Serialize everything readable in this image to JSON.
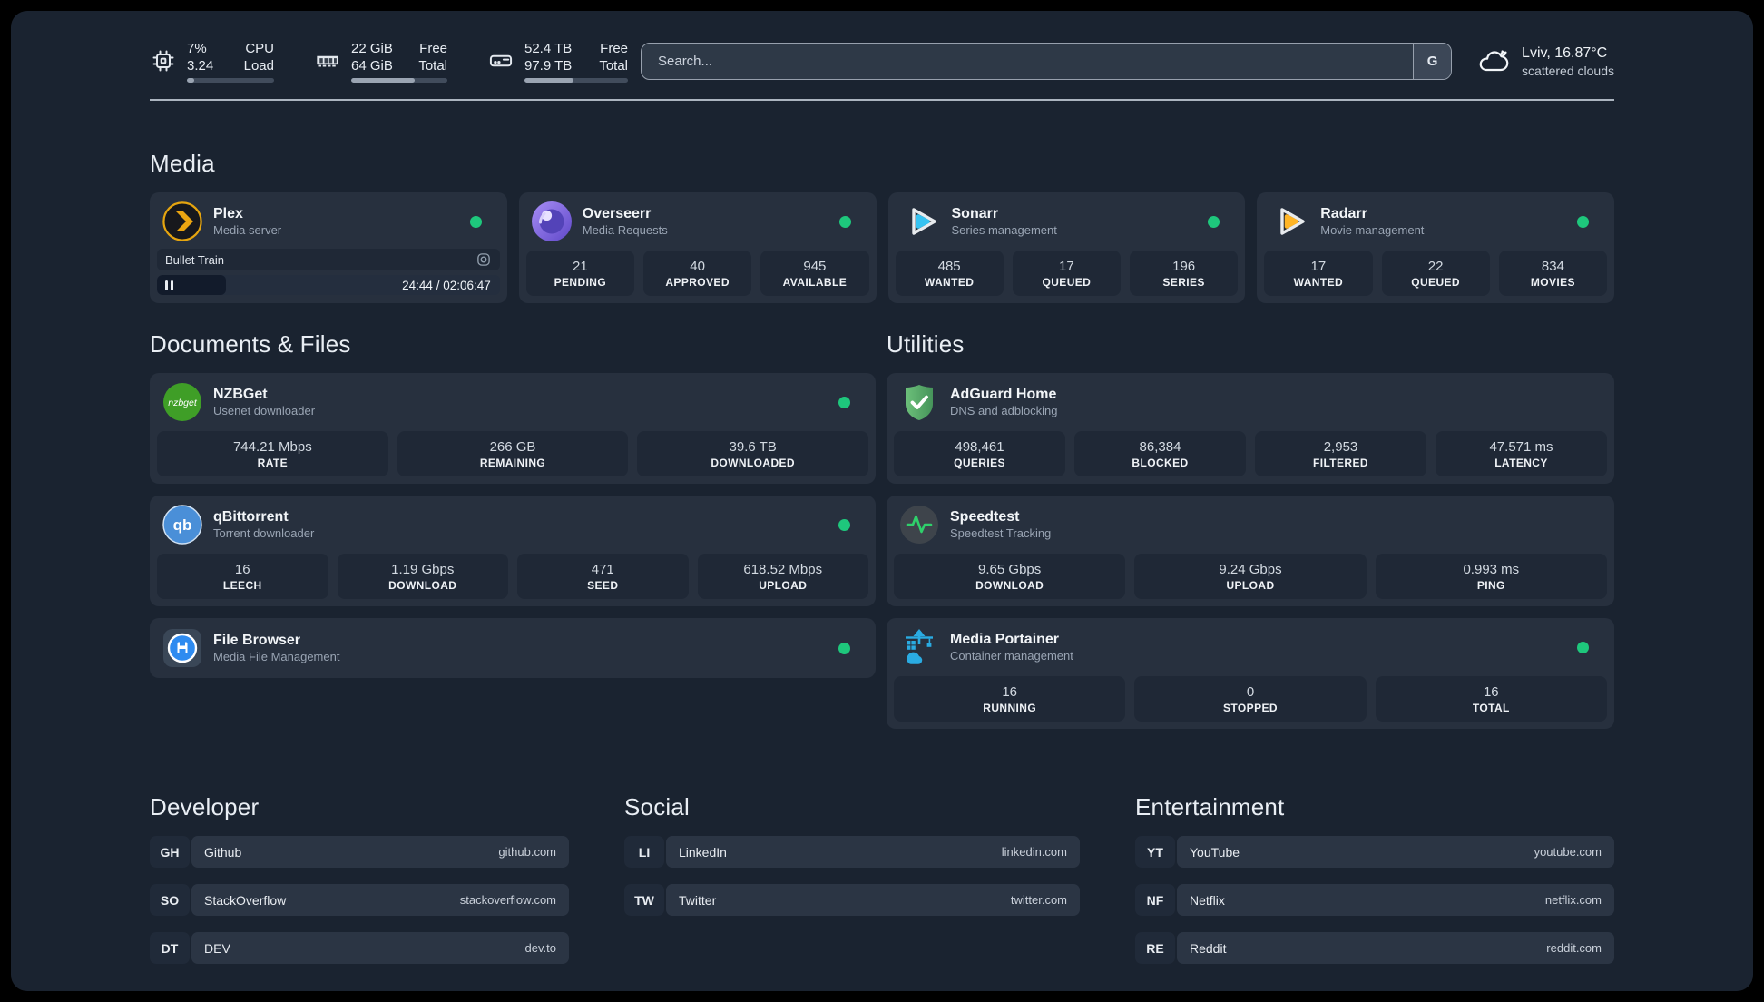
{
  "colors": {
    "status_online": "#1ec77c",
    "page_background": "#1a2330",
    "card_background": "#27303e",
    "plex_amber": "#e5a00d",
    "sonarr_blue": "#37c3f1",
    "radarr_amber": "#ffb526",
    "nzbget_green": "#3f9e27",
    "qbittorrent_blue": "#4a8fd8",
    "adguard_green": "#5cb46c",
    "speedtest_pulse": "#2fd06b",
    "portainer_blue": "#2aabe2",
    "filebrowser_blue": "#2e8bf0"
  },
  "header": {
    "cpu": {
      "top_value": "7%",
      "bottom_value": "3.24",
      "top_label": "CPU",
      "bottom_label": "Load",
      "progress_pct": 8
    },
    "memory": {
      "top_value": "22 GiB",
      "bottom_value": "64 GiB",
      "top_label": "Free",
      "bottom_label": "Total",
      "progress_pct": 66
    },
    "storage": {
      "top_value": "52.4 TB",
      "bottom_value": "97.9 TB",
      "top_label": "Free",
      "bottom_label": "Total",
      "progress_pct": 47
    },
    "search": {
      "placeholder": "Search...",
      "engine_button": "G"
    },
    "weather": {
      "location_temperature": "Lviv, 16.87°C",
      "condition": "scattered clouds"
    }
  },
  "sections": {
    "media": {
      "title": "Media",
      "plex": {
        "name": "Plex",
        "description": "Media server",
        "status": "online",
        "now_playing": {
          "title": "Bullet Train",
          "time": "24:44 / 02:06:47",
          "progress_pct": 20,
          "state": "paused"
        }
      },
      "overseerr": {
        "name": "Overseerr",
        "description": "Media Requests",
        "status": "online",
        "stats": [
          {
            "value": "21",
            "label": "PENDING"
          },
          {
            "value": "40",
            "label": "APPROVED"
          },
          {
            "value": "945",
            "label": "AVAILABLE"
          }
        ]
      },
      "sonarr": {
        "name": "Sonarr",
        "description": "Series management",
        "status": "online",
        "stats": [
          {
            "value": "485",
            "label": "WANTED"
          },
          {
            "value": "17",
            "label": "QUEUED"
          },
          {
            "value": "196",
            "label": "SERIES"
          }
        ]
      },
      "radarr": {
        "name": "Radarr",
        "description": "Movie management",
        "status": "online",
        "stats": [
          {
            "value": "17",
            "label": "WANTED"
          },
          {
            "value": "22",
            "label": "QUEUED"
          },
          {
            "value": "834",
            "label": "MOVIES"
          }
        ]
      }
    },
    "documents": {
      "title": "Documents & Files",
      "nzbget": {
        "name": "NZBGet",
        "description": "Usenet downloader",
        "status": "online",
        "stats": [
          {
            "value": "744.21 Mbps",
            "label": "RATE"
          },
          {
            "value": "266 GB",
            "label": "REMAINING"
          },
          {
            "value": "39.6 TB",
            "label": "DOWNLOADED"
          }
        ]
      },
      "qbittorrent": {
        "name": "qBittorrent",
        "description": "Torrent downloader",
        "status": "online",
        "stats": [
          {
            "value": "16",
            "label": "LEECH"
          },
          {
            "value": "1.19 Gbps",
            "label": "DOWNLOAD"
          },
          {
            "value": "471",
            "label": "SEED"
          },
          {
            "value": "618.52 Mbps",
            "label": "UPLOAD"
          }
        ]
      },
      "filebrowser": {
        "name": "File Browser",
        "description": "Media File Management",
        "status": "online"
      }
    },
    "utilities": {
      "title": "Utilities",
      "adguard": {
        "name": "AdGuard Home",
        "description": "DNS and adblocking",
        "stats": [
          {
            "value": "498,461",
            "label": "QUERIES"
          },
          {
            "value": "86,384",
            "label": "BLOCKED"
          },
          {
            "value": "2,953",
            "label": "FILTERED"
          },
          {
            "value": "47.571 ms",
            "label": "LATENCY"
          }
        ]
      },
      "speedtest": {
        "name": "Speedtest",
        "description": "Speedtest Tracking",
        "stats": [
          {
            "value": "9.65 Gbps",
            "label": "DOWNLOAD"
          },
          {
            "value": "9.24 Gbps",
            "label": "UPLOAD"
          },
          {
            "value": "0.993 ms",
            "label": "PING"
          }
        ]
      },
      "portainer": {
        "name": "Media Portainer",
        "description": "Container management",
        "status": "online",
        "stats": [
          {
            "value": "16",
            "label": "RUNNING"
          },
          {
            "value": "0",
            "label": "STOPPED"
          },
          {
            "value": "16",
            "label": "TOTAL"
          }
        ]
      }
    },
    "bookmarks": {
      "developer": {
        "title": "Developer",
        "links": [
          {
            "abbr": "GH",
            "name": "Github",
            "url": "github.com"
          },
          {
            "abbr": "SO",
            "name": "StackOverflow",
            "url": "stackoverflow.com"
          },
          {
            "abbr": "DT",
            "name": "DEV",
            "url": "dev.to"
          }
        ]
      },
      "social": {
        "title": "Social",
        "links": [
          {
            "abbr": "LI",
            "name": "LinkedIn",
            "url": "linkedin.com"
          },
          {
            "abbr": "TW",
            "name": "Twitter",
            "url": "twitter.com"
          }
        ]
      },
      "entertainment": {
        "title": "Entertainment",
        "links": [
          {
            "abbr": "YT",
            "name": "YouTube",
            "url": "youtube.com"
          },
          {
            "abbr": "NF",
            "name": "Netflix",
            "url": "netflix.com"
          },
          {
            "abbr": "RE",
            "name": "Reddit",
            "url": "reddit.com"
          }
        ]
      }
    }
  }
}
